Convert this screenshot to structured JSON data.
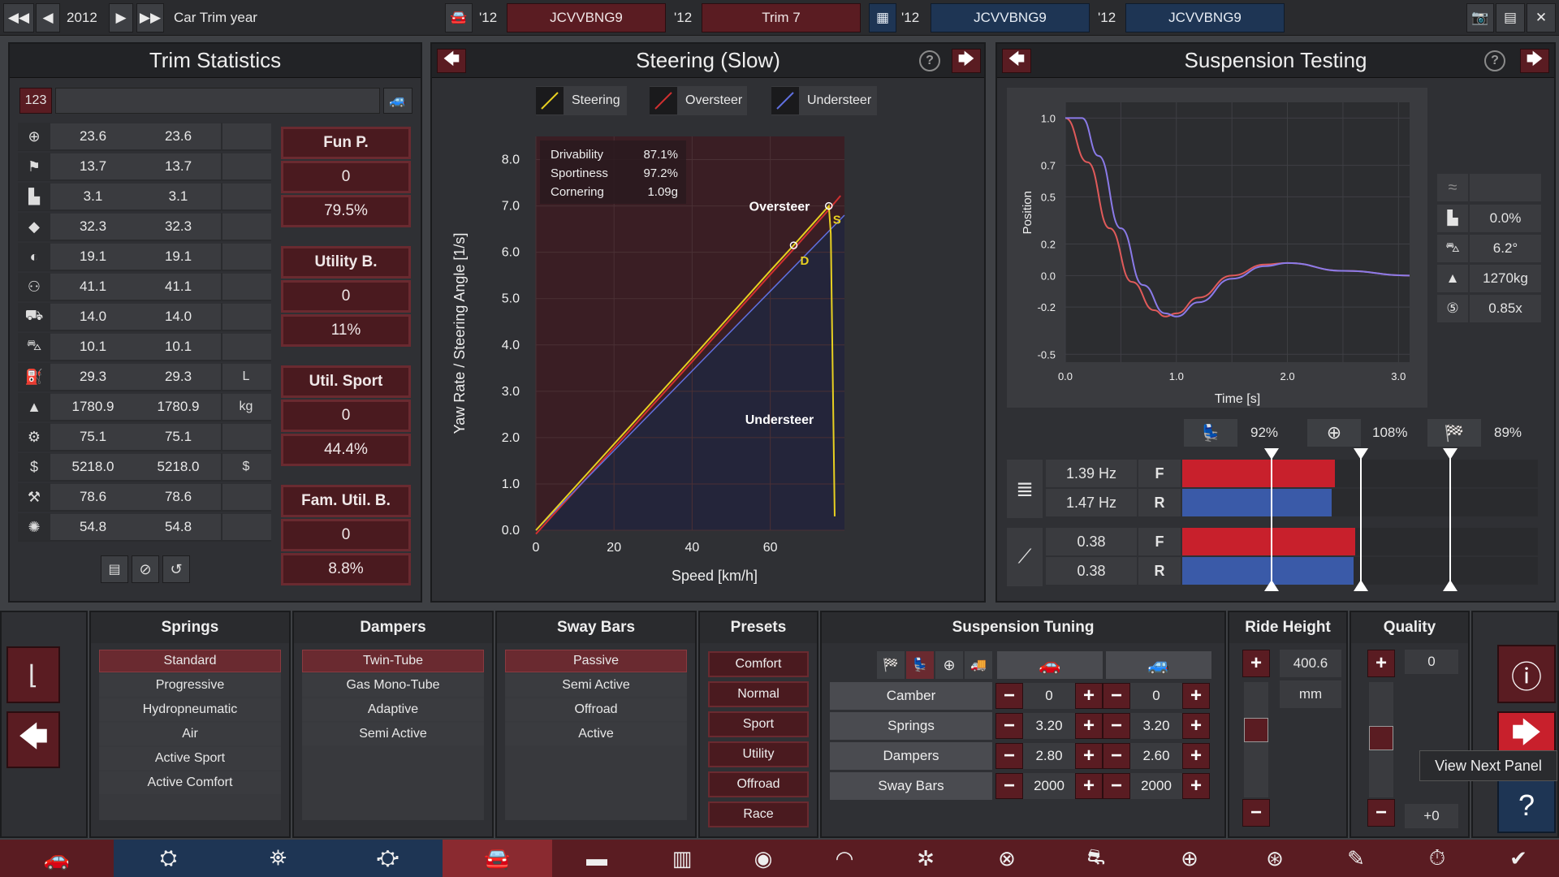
{
  "topbar": {
    "year": "2012",
    "car_trim_year_label": "Car Trim year",
    "model_year_1": "'12",
    "model_name_1": "JCVVBNG9",
    "model_year_2": "'12",
    "trim_name": "Trim 7",
    "model_year_3": "'12",
    "compare_name_1": "JCVVBNG9",
    "model_year_4": "'12",
    "compare_name_2": "JCVVBNG9"
  },
  "trim_stats": {
    "title": "Trim Statistics",
    "number_badge": "123",
    "rows": [
      {
        "icon": "steering-wheel-icon",
        "v1": "23.6",
        "v2": "23.6",
        "unit": ""
      },
      {
        "icon": "race-flag-icon",
        "v1": "13.7",
        "v2": "13.7",
        "unit": ""
      },
      {
        "icon": "seat-icon",
        "v1": "3.1",
        "v2": "3.1",
        "unit": ""
      },
      {
        "icon": "gem-icon",
        "v1": "32.3",
        "v2": "32.3",
        "unit": ""
      },
      {
        "icon": "safety-icon",
        "v1": "19.1",
        "v2": "19.1",
        "unit": ""
      },
      {
        "icon": "passengers-icon",
        "v1": "41.1",
        "v2": "41.1",
        "unit": ""
      },
      {
        "icon": "cargo-car-icon",
        "v1": "14.0",
        "v2": "14.0",
        "unit": ""
      },
      {
        "icon": "offroad-car-icon",
        "v1": "10.1",
        "v2": "10.1",
        "unit": ""
      },
      {
        "icon": "fuel-icon",
        "v1": "29.3",
        "v2": "29.3",
        "unit": "L"
      },
      {
        "icon": "weight-icon",
        "v1": "1780.9",
        "v2": "1780.9",
        "unit": "kg"
      },
      {
        "icon": "service-icon",
        "v1": "75.1",
        "v2": "75.1",
        "unit": ""
      },
      {
        "icon": "cost-icon",
        "v1": "5218.0",
        "v2": "5218.0",
        "unit": "$"
      },
      {
        "icon": "production-icon",
        "v1": "78.6",
        "v2": "78.6",
        "unit": ""
      },
      {
        "icon": "engineering-icon",
        "v1": "54.8",
        "v2": "54.8",
        "unit": ""
      }
    ],
    "scores": [
      {
        "title": "Fun P.",
        "rank": "0",
        "value": "79.5%"
      },
      {
        "title": "Utility B.",
        "rank": "0",
        "value": "11%"
      },
      {
        "title": "Util. Sport",
        "rank": "0",
        "value": "44.4%"
      },
      {
        "title": "Fam. Util. B.",
        "rank": "0",
        "value": "8.8%"
      }
    ]
  },
  "steering": {
    "title": "Steering (Slow)",
    "legend": [
      "Steering",
      "Oversteer",
      "Understeer"
    ],
    "stats": [
      {
        "label": "Drivability",
        "value": "87.1%"
      },
      {
        "label": "Sportiness",
        "value": "97.2%"
      },
      {
        "label": "Cornering",
        "value": "1.09g"
      }
    ],
    "oversteer_label": "Oversteer",
    "understeer_label": "Understeer",
    "marker_d": "D",
    "marker_s": "S"
  },
  "chart_data": [
    {
      "type": "line",
      "title": "Steering (Slow)",
      "xlabel": "Speed [km/h]",
      "ylabel": "Yaw Rate / Steering Angle [1/s]",
      "xlim": [
        0,
        79
      ],
      "ylim": [
        0,
        8.5
      ],
      "xticks": [
        "0",
        "20",
        "40",
        "60"
      ],
      "yticks": [
        "0.0",
        "1.0",
        "2.0",
        "3.0",
        "4.0",
        "5.0",
        "6.0",
        "7.0",
        "8.0"
      ],
      "series": [
        {
          "name": "Steering",
          "x": [
            0,
            20,
            40,
            60,
            66,
            75,
            78
          ],
          "y": [
            0,
            1.86,
            3.72,
            5.6,
            6.15,
            7.0,
            7.3
          ]
        },
        {
          "name": "Understeer",
          "x": [
            0,
            20,
            40,
            60,
            79
          ],
          "y": [
            0,
            1.72,
            3.44,
            5.16,
            6.8
          ]
        }
      ],
      "legend": "top"
    },
    {
      "type": "line",
      "title": "Suspension Testing",
      "xlabel": "Time [s]",
      "ylabel": "Position",
      "xlim": [
        0,
        3.1
      ],
      "ylim": [
        -0.55,
        1.1
      ],
      "xticks": [
        "0.0",
        "1.0",
        "2.0",
        "3.0"
      ],
      "yticks": [
        "1.0",
        "0.7",
        "0.5",
        "0.2",
        "0.0",
        "-0.2",
        "-0.5"
      ],
      "series": [
        {
          "x": [
            0,
            0.2,
            0.4,
            0.6,
            0.8,
            0.9,
            1.0,
            1.2,
            1.5,
            1.8,
            2.0,
            2.5,
            3.1
          ],
          "y": [
            1.0,
            0.72,
            0.3,
            -0.04,
            -0.22,
            -0.26,
            -0.24,
            -0.14,
            0.0,
            0.07,
            0.08,
            0.03,
            0.0
          ]
        },
        {
          "x": [
            0,
            0.15,
            0.3,
            0.5,
            0.7,
            0.9,
            1.0,
            1.2,
            1.5,
            1.8,
            2.0,
            2.5,
            3.1
          ],
          "y": [
            1.0,
            1.0,
            0.76,
            0.3,
            -0.06,
            -0.24,
            -0.26,
            -0.17,
            -0.02,
            0.06,
            0.08,
            0.03,
            0.0
          ]
        }
      ]
    }
  ],
  "suspension_testing": {
    "title": "Suspension Testing",
    "side_stats": [
      "0.0%",
      "6.2°",
      "1270kg",
      "0.85x"
    ],
    "bar_pcts": {
      "comfort": "92%",
      "handling": "108%",
      "sport": "89%"
    },
    "springs": {
      "front": "1.39 Hz",
      "rear": "1.47 Hz",
      "front_bar": 0.86,
      "rear_bar": 0.84
    },
    "dampers": {
      "front": "0.38",
      "rear": "0.38",
      "front_bar": 0.9,
      "rear_bar": 0.89
    },
    "label_f": "F",
    "label_r": "R"
  },
  "springs": {
    "title": "Springs",
    "options": [
      "Standard",
      "Progressive",
      "Hydropneumatic",
      "Air",
      "Active Sport",
      "Active Comfort"
    ]
  },
  "dampers": {
    "title": "Dampers",
    "options": [
      "Twin-Tube",
      "Gas Mono-Tube",
      "Adaptive",
      "Semi Active"
    ]
  },
  "sway_bars": {
    "title": "Sway Bars",
    "options": [
      "Passive",
      "Semi Active",
      "Offroad",
      "Active"
    ]
  },
  "presets": {
    "title": "Presets",
    "options": [
      "Comfort",
      "Normal",
      "Sport",
      "Utility",
      "Offroad",
      "Race"
    ]
  },
  "suspension_tuning": {
    "title": "Suspension Tuning",
    "rows": [
      {
        "label": "Camber",
        "front": "0",
        "rear": "0"
      },
      {
        "label": "Springs",
        "front": "3.20",
        "rear": "3.20"
      },
      {
        "label": "Dampers",
        "front": "2.80",
        "rear": "2.60"
      },
      {
        "label": "Sway Bars",
        "front": "2000",
        "rear": "2000"
      }
    ]
  },
  "ride_height": {
    "title": "Ride Height",
    "value": "400.6",
    "unit": "mm"
  },
  "quality": {
    "title": "Quality",
    "value": "0",
    "delta": "+0"
  },
  "tooltip": "View Next Panel",
  "colors": {
    "accent_red": "#5a1c22",
    "steering_line": "#e8d020",
    "oversteer_line": "#d03030",
    "understeer_line": "#6070e0",
    "bar_front": "#c8202c",
    "bar_rear": "#3a5aa8"
  }
}
